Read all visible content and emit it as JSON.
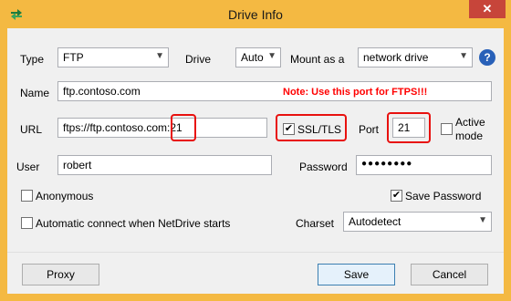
{
  "window": {
    "title": "Drive Info",
    "close_label": "✕"
  },
  "type": {
    "label": "Type",
    "value": "FTP"
  },
  "drive": {
    "label": "Drive",
    "value": "Auto"
  },
  "mount": {
    "label": "Mount as a",
    "value": "network drive"
  },
  "help": {
    "label": "?"
  },
  "name": {
    "label": "Name",
    "value": "ftp.contoso.com"
  },
  "note": "Note: Use this port for FTPS!!!",
  "url": {
    "label": "URL",
    "value": "ftps://ftp.contoso.com:21"
  },
  "ssl": {
    "label": "SSL/TLS",
    "checked": true
  },
  "port": {
    "label": "Port",
    "value": "21"
  },
  "active_mode": {
    "label_line1": "Active",
    "label_line2": "mode",
    "checked": false
  },
  "user": {
    "label": "User",
    "value": "robert"
  },
  "password": {
    "label": "Password",
    "value": "●●●●●●●●"
  },
  "anonymous": {
    "label": "Anonymous",
    "checked": false
  },
  "save_password": {
    "label": "Save Password",
    "checked": true
  },
  "auto_connect": {
    "label": "Automatic connect when NetDrive starts",
    "checked": false
  },
  "charset": {
    "label": "Charset",
    "value": "Autodetect"
  },
  "buttons": {
    "proxy": "Proxy",
    "save": "Save",
    "cancel": "Cancel"
  },
  "colors": {
    "title_bar": "#f4b942",
    "note": "#ff0000",
    "highlight_box": "#e8110f",
    "close": "#c7453a"
  },
  "icons": {
    "app": "netdrive-arrows-icon",
    "help": "help-circle-icon",
    "close": "close-icon",
    "dropdown": "chevron-down-icon"
  }
}
